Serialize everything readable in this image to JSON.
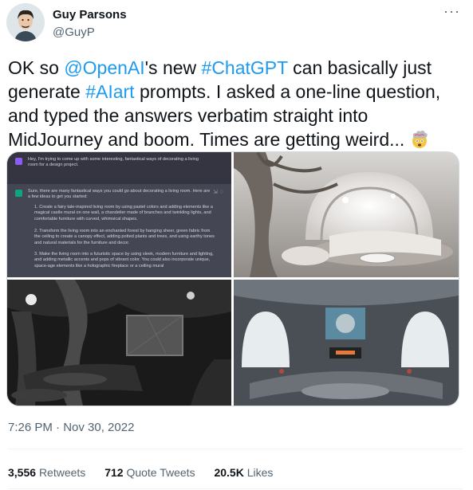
{
  "author": {
    "name": "Guy Parsons",
    "handle": "@GuyP"
  },
  "more_icon": "···",
  "tweet": {
    "t1": "OK so ",
    "mention": "@OpenAI",
    "t2": "'s new ",
    "hashtag1": "#ChatGPT",
    "t3": " can basically just generate ",
    "hashtag2": "#AIart",
    "t4": " prompts. I asked a one-line question, and typed the answers verbatim straight into MidJourney and boom. Times are getting weird...",
    "emoji": "exploding-head-emoji"
  },
  "chat_screenshot": {
    "question": "Hey, I'm trying to come up with some interesting, fantastical ways of decorating a living room for a design project.",
    "answer_intro": "Sure, there are many fantastical ways you could go about decorating a living room. Here are a few ideas to get you started:",
    "items": [
      "1. Create a fairy tale-inspired living room by using pastel colors and adding elements like a magical castle mural on one wall, a chandelier made of branches and twinkling lights, and comfortable furniture with curved, whimsical shapes.",
      "2. Transform the living room into an enchanted forest by hanging sheer, green fabric from the ceiling to create a canopy effect, adding potted plants and trees, and using earthy tones and natural materials for the furniture and decor.",
      "3. Make the living room into a futuristic space by using sleek, modern furniture and lighting, and adding metallic accents and pops of vibrant color. You could also incorporate unique, space-age elements like a holographic fireplace or a ceiling mural"
    ]
  },
  "timestamp": "7:26 PM · Nov 30, 2022",
  "stats": {
    "retweets_count": "3,556",
    "retweets_label": "Retweets",
    "quotes_count": "712",
    "quotes_label": "Quote Tweets",
    "likes_count": "20.5K",
    "likes_label": "Likes"
  },
  "colors": {
    "link": "#1d9bf0",
    "text": "#0f1419",
    "secondary": "#536471",
    "chat_bg": "#343541",
    "chat_answer_bg": "#444654"
  }
}
